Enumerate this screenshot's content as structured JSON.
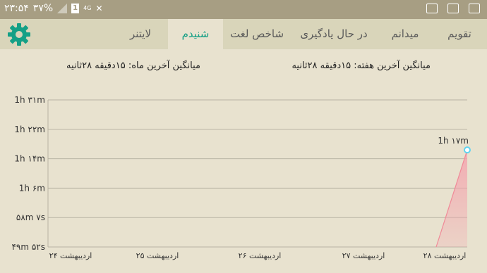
{
  "status_bar": {
    "time": "۲۳:۵۴",
    "battery": "۳۷%",
    "network": "4G",
    "sim_badge": "1",
    "icons": [
      "signal-icon",
      "sim-icon",
      "mute-icon",
      "email-icon",
      "gallery-icon",
      "close-box-icon"
    ]
  },
  "tabs": [
    {
      "label": "تقویم",
      "active": false
    },
    {
      "label": "میدانم",
      "active": false
    },
    {
      "label": "در حال یادگیری",
      "active": false
    },
    {
      "label": "شاخص لغت",
      "active": false
    },
    {
      "label": "شنیدم",
      "active": true
    },
    {
      "label": "لایتنر",
      "active": false
    }
  ],
  "settings_icon": "gear-icon",
  "colors": {
    "accent": "#129e84",
    "status_bar": "#a79e83",
    "tab_bar": "#d9d5ba",
    "background": "#e8e2cf",
    "series": "#f4a3ad",
    "point": "#5fd3f0"
  },
  "averages": {
    "week": "میانگین آخرین هفته: ۱۵دقیقه  ۲۸ثانیه",
    "month": "میانگین آخرین ماه: ۱۵دقیقه  ۲۸ثانیه"
  },
  "chart_data": {
    "type": "area",
    "y_ticks": [
      "1h ۳۱m",
      "1h ۲۲m",
      "1h ۱۴m",
      "1h ۶m",
      "۵۸m ۷s",
      "۴۹m ۵۲s"
    ],
    "x": [
      "۲۴ اردیبهشت",
      "۲۵ اردیبهشت",
      "۲۶ اردیبهشت",
      "۲۷ اردیبهشت",
      "۲۸ اردیبهشت"
    ],
    "values": [
      null,
      null,
      null,
      null,
      "1h ۱۷m"
    ],
    "point_label": "1h ۱۷m",
    "grid": true
  }
}
